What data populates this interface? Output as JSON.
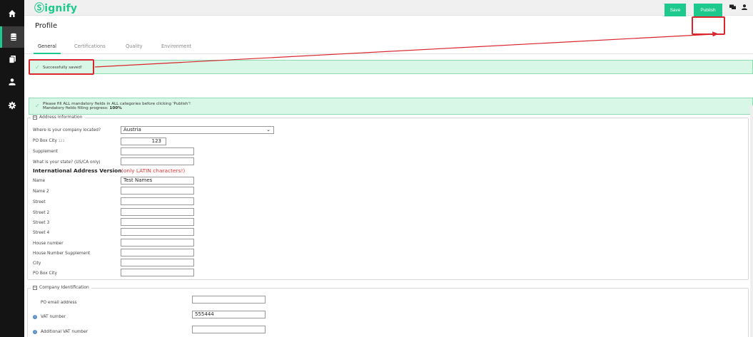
{
  "brand": {
    "logo": "Ⓢignify",
    "accent_color": "#1ec98e",
    "highlight_color": "#d9252d"
  },
  "nav": {
    "items": [
      {
        "icon": "home-icon"
      },
      {
        "icon": "database-icon"
      },
      {
        "icon": "documents-icon"
      },
      {
        "icon": "user-handshake-icon"
      },
      {
        "icon": "gear-icon"
      }
    ]
  },
  "header": {
    "icons": [
      "chat-icon",
      "user-icon"
    ]
  },
  "page": {
    "title": "Profile",
    "save_label": "Save",
    "publish_label": "Publish"
  },
  "tabs": [
    "General",
    "Certifications",
    "Quality",
    "Environment"
  ],
  "alerts": {
    "saved": "Successfully saved!",
    "mandatory_line1": "Please fill ALL mandatory fields in ALL categories before clicking 'Publish'!",
    "progress_label": "Mandatory fields filling progress:",
    "progress_value": "100%"
  },
  "address": {
    "legend": "Address Information",
    "location_label": "Where is your company located?",
    "location_value": "Austria",
    "po_box_city_label": "PO Box City",
    "po_box_city_sup": "123",
    "po_box_city_value": "123",
    "supplement_label": "Supplement",
    "state_label": "What is your state? (US/CA only)",
    "intl_heading": "International Address Version",
    "intl_note": "(only LATIN characters!)",
    "fields": [
      {
        "label": "Name",
        "value": "Test Names"
      },
      {
        "label": "Name 2",
        "value": ""
      },
      {
        "label": "Street",
        "value": ""
      },
      {
        "label": "Street 2",
        "value": ""
      },
      {
        "label": "Street 3",
        "value": ""
      },
      {
        "label": "Street 4",
        "value": ""
      },
      {
        "label": "House number",
        "value": ""
      },
      {
        "label": "House Number Supplement",
        "value": ""
      },
      {
        "label": "City",
        "value": ""
      },
      {
        "label": "PO Box City",
        "value": ""
      }
    ]
  },
  "company": {
    "legend": "Company Identification",
    "po_email_label": "PO email address",
    "po_email_value": "",
    "vat_label": "VAT number",
    "vat_value": "555444",
    "add_vat_label": "Additional VAT number",
    "add_vat_value": ""
  }
}
